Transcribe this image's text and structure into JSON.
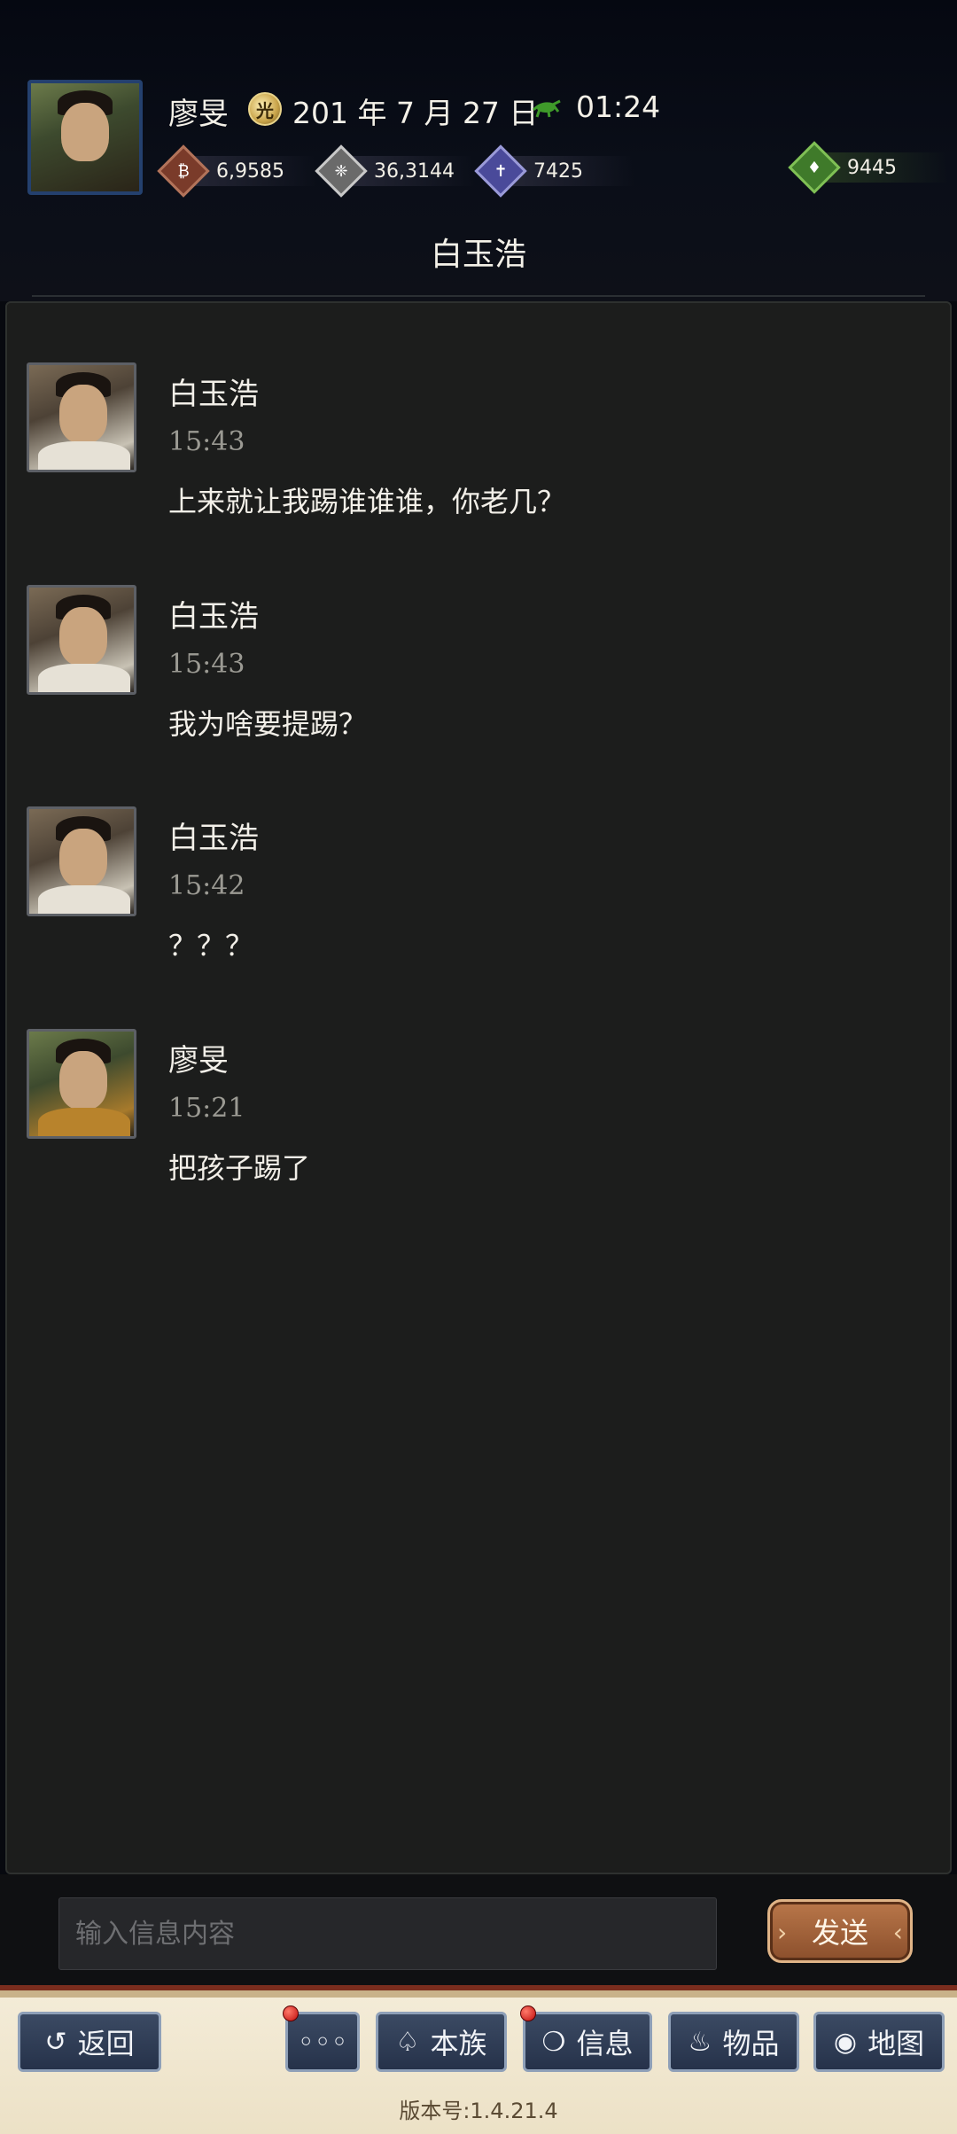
{
  "header": {
    "player_name": "廖旻",
    "date_icon_glyph": "光",
    "date": "201 年 7 月 27 日",
    "time": "01:24",
    "resources": [
      {
        "icon": "coin-icon",
        "glyph": "₿",
        "value": "6,9585",
        "color": "#7a3b2a"
      },
      {
        "icon": "grain-icon",
        "glyph": "❈",
        "value": "36,3144",
        "color": "#6a6a6a"
      },
      {
        "icon": "soldier-icon",
        "glyph": "✝",
        "value": "7425",
        "color": "#4a4a9a"
      },
      {
        "icon": "money-bag-icon",
        "glyph": "♦",
        "value": "9445",
        "color": "#3f7a2a"
      }
    ],
    "conversation_title": "白玉浩"
  },
  "messages": [
    {
      "name": "白玉浩",
      "time": "15:43",
      "text": "上来就让我踢谁谁谁，你老几？",
      "avatar": "white"
    },
    {
      "name": "白玉浩",
      "time": "15:43",
      "text": "我为啥要提踢？",
      "avatar": "white"
    },
    {
      "name": "白玉浩",
      "time": "15:42",
      "text": "？？？",
      "avatar": "white"
    },
    {
      "name": "廖旻",
      "time": "15:21",
      "text": "把孩子踢了",
      "avatar": "gold"
    }
  ],
  "input": {
    "placeholder": "输入信息内容",
    "send_label": "发送"
  },
  "nav": {
    "back_label": "返回",
    "more_label": "◦◦◦",
    "clan_label": "本族",
    "info_label": "信息",
    "items_label": "物品",
    "map_label": "地图",
    "version": "版本号:1.4.21.4"
  }
}
